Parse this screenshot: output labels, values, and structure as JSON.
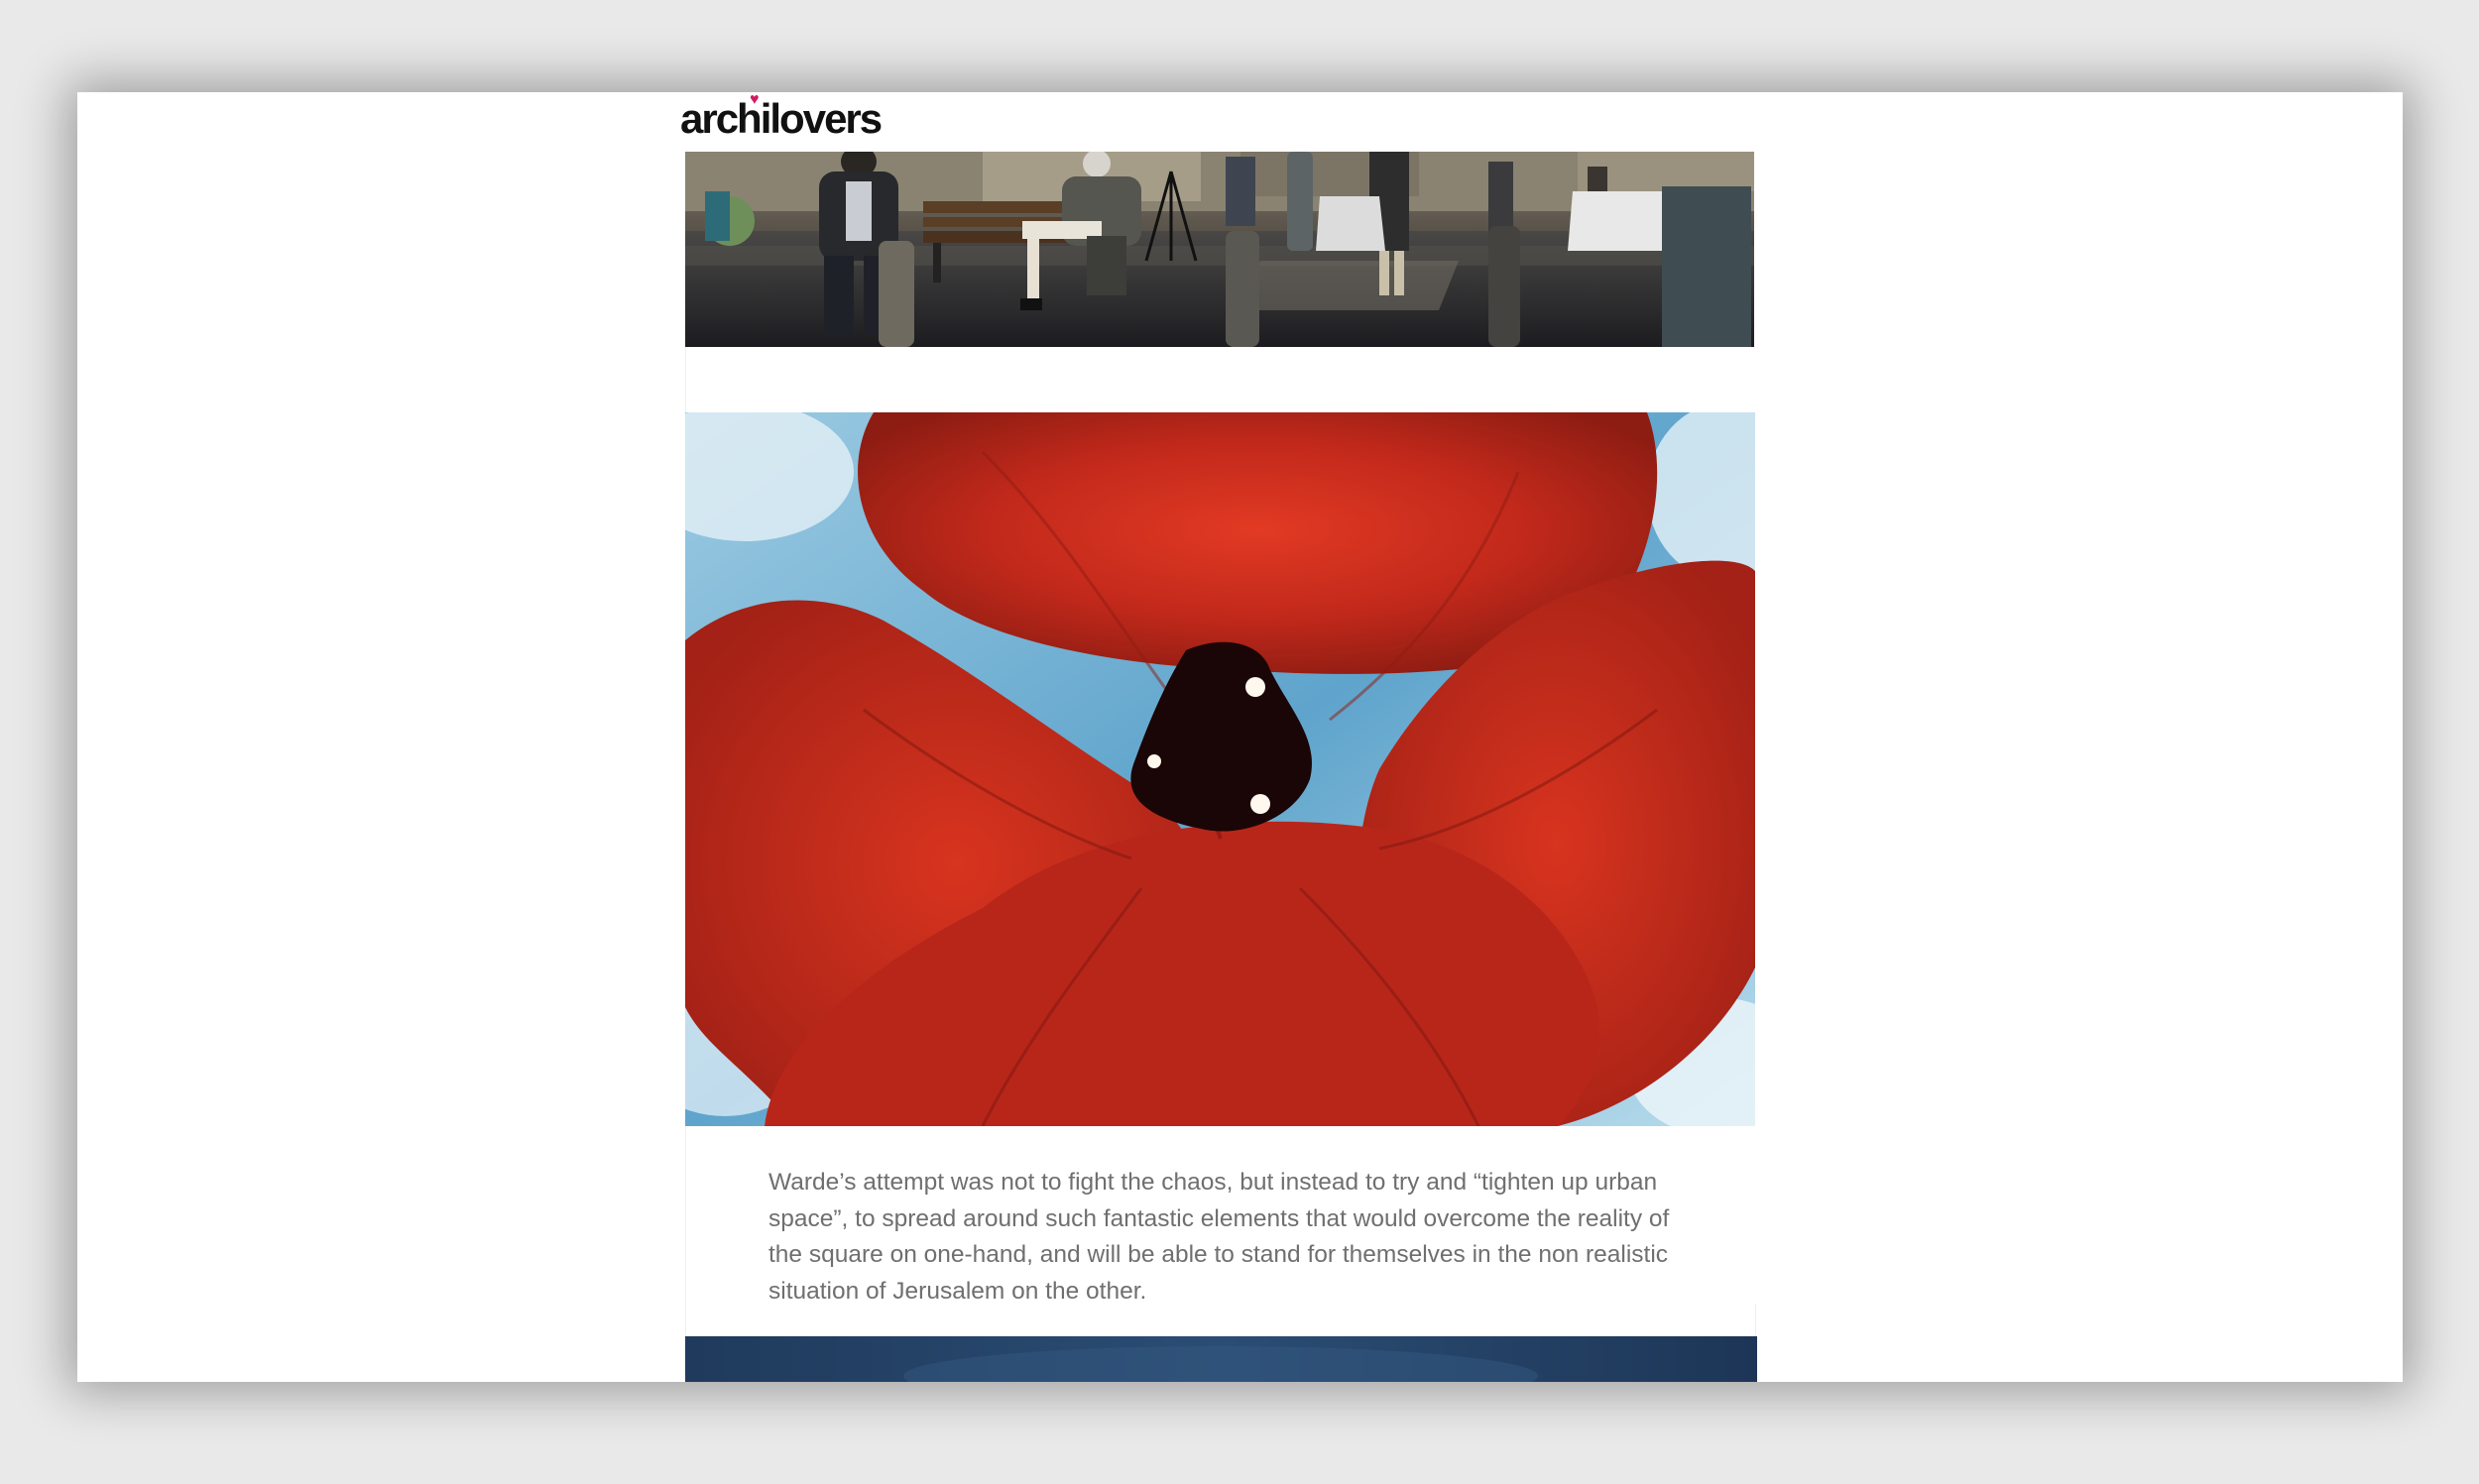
{
  "site": {
    "logo_text": "archilovers"
  },
  "article": {
    "caption": "Warde’s attempt was not to fight the chaos, but instead to try and “tighten up urban space”, to spread around such fantastic elements that would overcome the reality of the square on one-hand, and will be able to stand for themselves in the non realistic situation of Jerusalem on the other."
  },
  "colors": {
    "background": "#e9e9e9",
    "page": "#ffffff",
    "caption_text": "#6f6f6f",
    "logo_heart": "#d11a66",
    "flower_red": "#c0281c",
    "sky_blue": "#8fc3dd"
  }
}
